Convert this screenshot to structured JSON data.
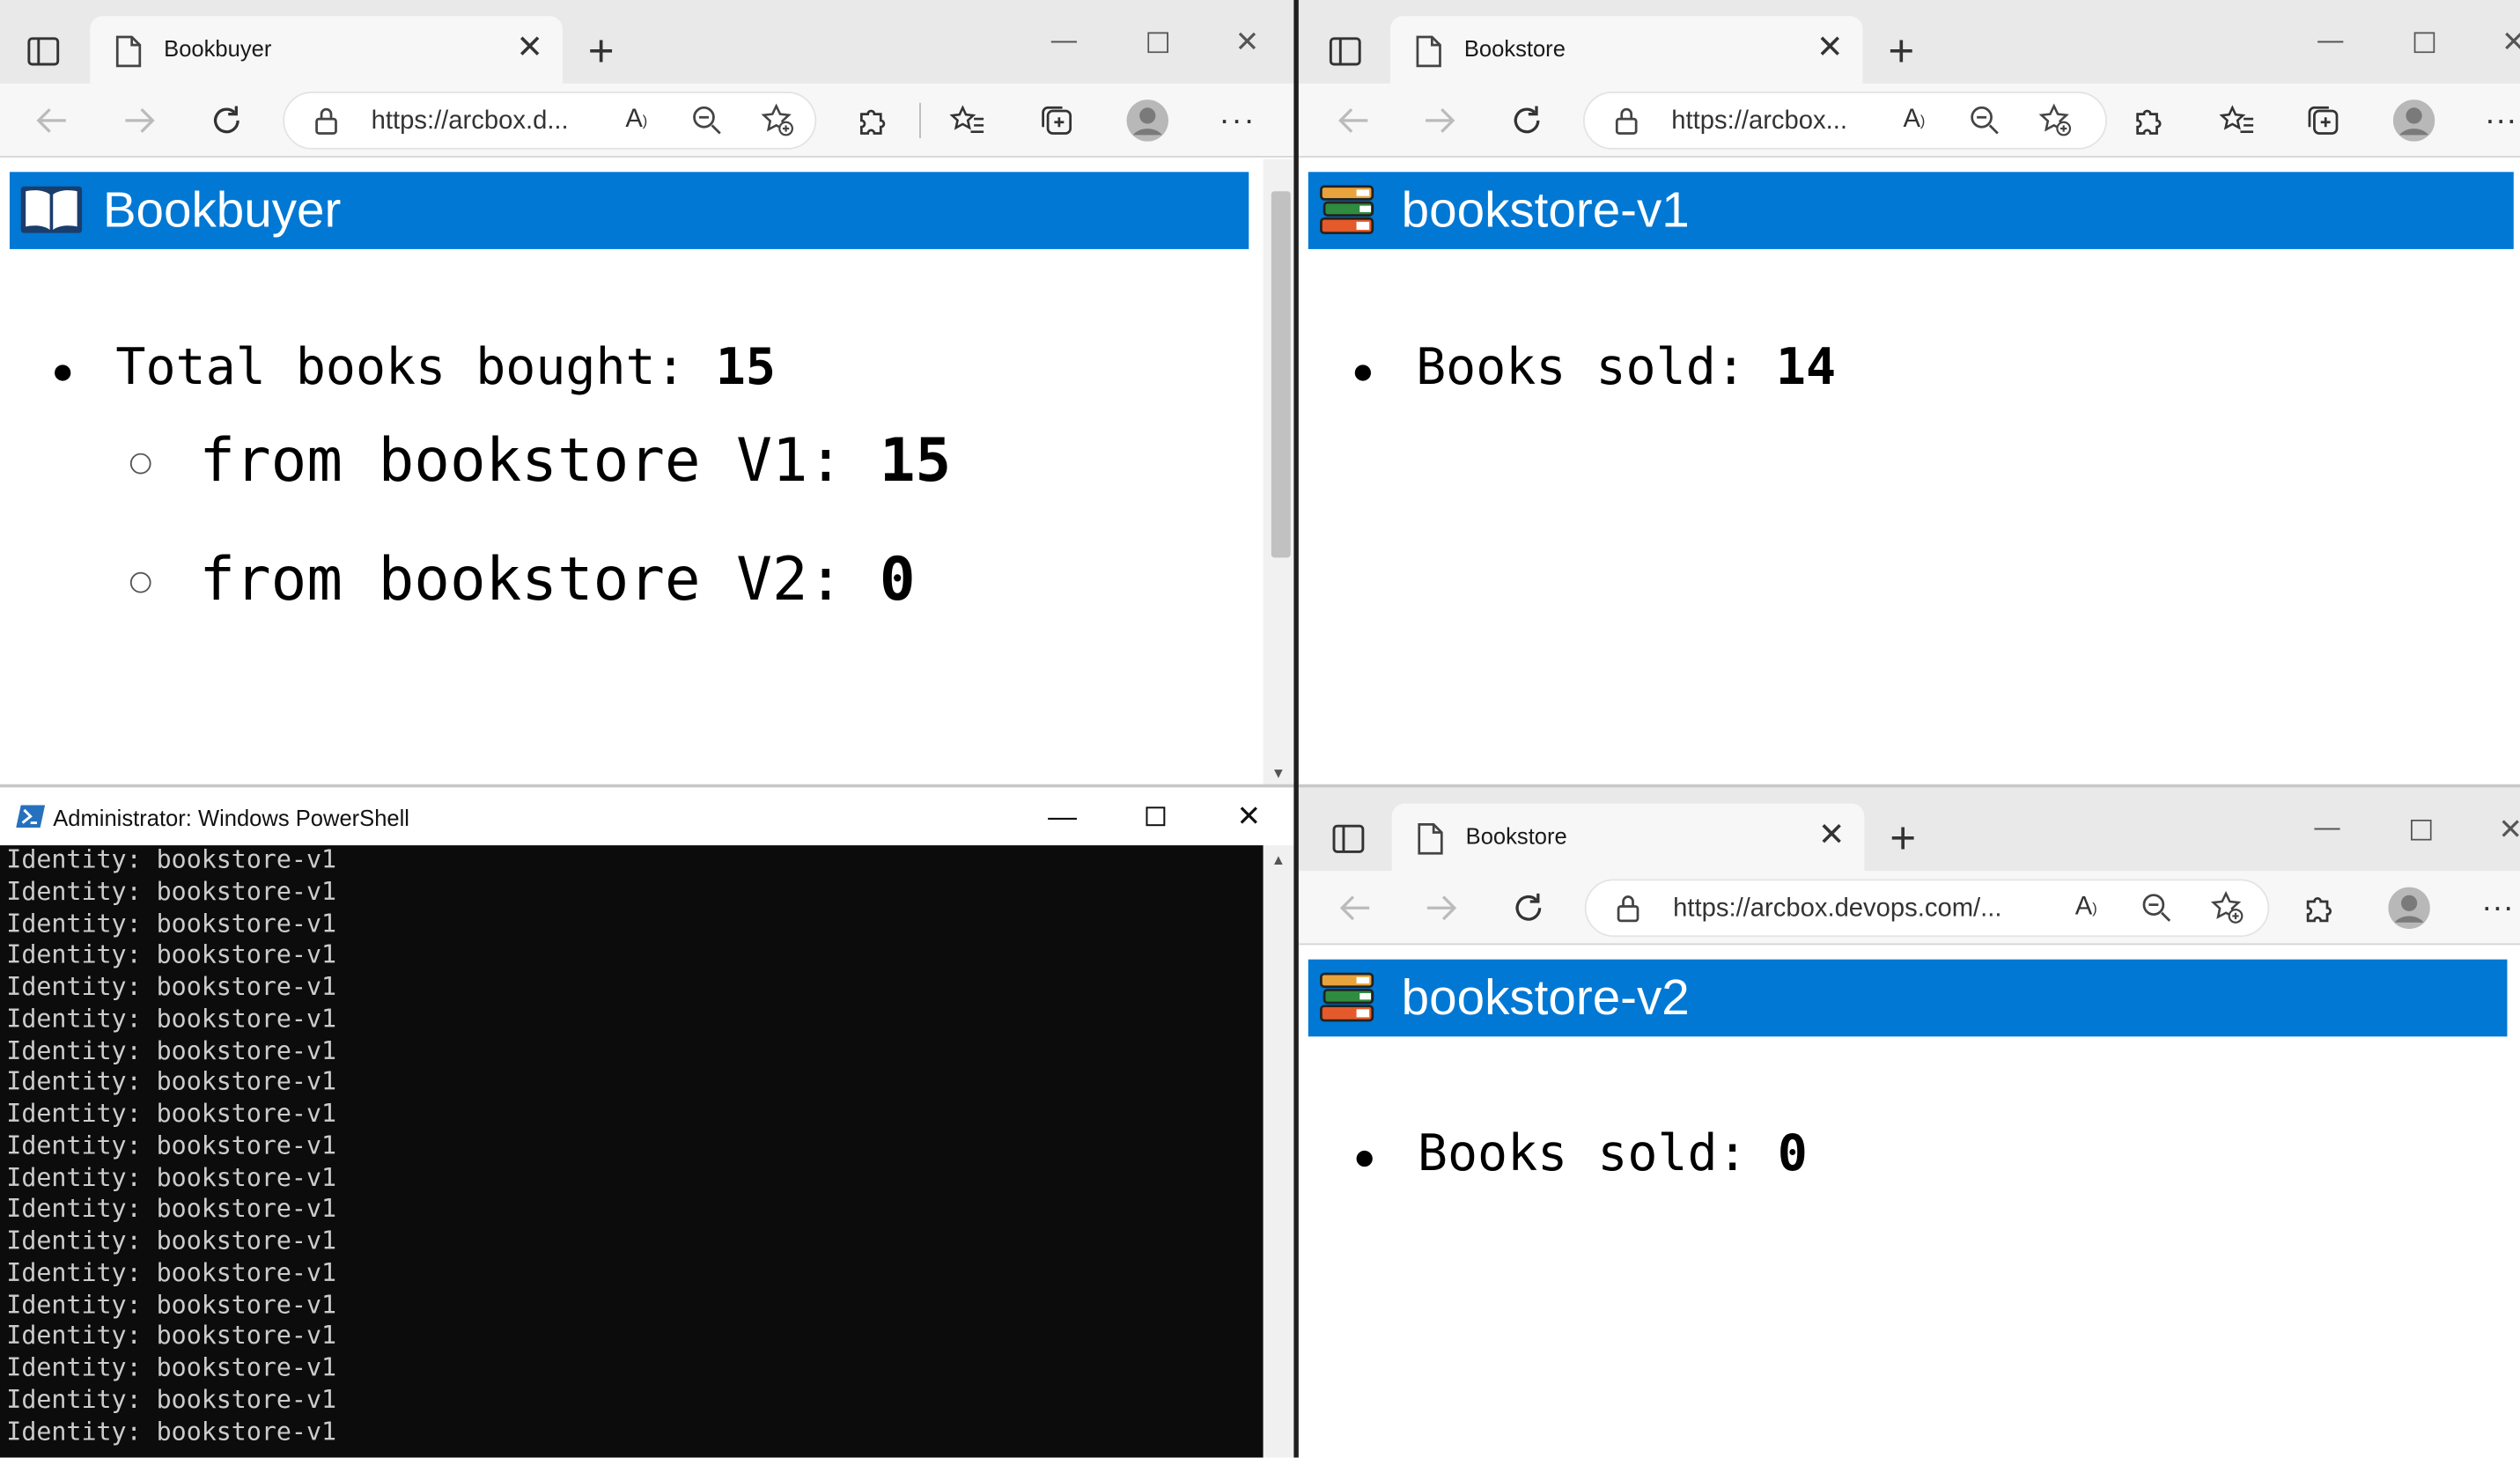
{
  "bookbuyer_window": {
    "tab_title": "Bookbuyer",
    "url": "https://arcbox.d...",
    "banner_title": "Bookbuyer",
    "total_label": "Total books bought: ",
    "total_value": "15",
    "v1_label": "from bookstore V1: ",
    "v1_value": "15",
    "v2_label": "from bookstore V2: ",
    "v2_value": "0"
  },
  "bookstore_v1_window": {
    "tab_title": "Bookstore",
    "url": "https://arcbox...",
    "banner_title": "bookstore-v1",
    "sold_label": "Books sold: ",
    "sold_value": "14"
  },
  "bookstore_v2_window": {
    "tab_title": "Bookstore",
    "url": "https://arcbox.devops.com/...",
    "banner_title": "bookstore-v2",
    "sold_label": "Books sold: ",
    "sold_value": "0"
  },
  "powershell": {
    "title": "Administrator: Windows PowerShell",
    "lines": [
      "Identity: bookstore-v1",
      "Identity: bookstore-v1",
      "Identity: bookstore-v1",
      "Identity: bookstore-v1",
      "Identity: bookstore-v1",
      "Identity: bookstore-v1",
      "Identity: bookstore-v1",
      "Identity: bookstore-v1",
      "Identity: bookstore-v1",
      "Identity: bookstore-v1",
      "Identity: bookstore-v1",
      "Identity: bookstore-v1",
      "Identity: bookstore-v1",
      "Identity: bookstore-v1",
      "Identity: bookstore-v1",
      "Identity: bookstore-v1",
      "Identity: bookstore-v1",
      "Identity: bookstore-v1",
      "Identity: bookstore-v1"
    ]
  },
  "colors": {
    "banner": "#0078d4",
    "terminal_bg": "#0c0c0c",
    "terminal_fg": "#cccccc"
  },
  "icons": [
    "sidebar-icon",
    "page-icon",
    "close-icon",
    "new-tab-icon",
    "back-icon",
    "forward-icon",
    "refresh-icon",
    "lock-icon",
    "read-aloud-icon",
    "zoom-icon",
    "favorite-add-icon",
    "extensions-icon",
    "favorites-icon",
    "collections-icon",
    "profile-icon",
    "more-icon",
    "open-book-icon",
    "books-stack-icon",
    "powershell-icon",
    "minimize-icon",
    "maximize-icon"
  ]
}
